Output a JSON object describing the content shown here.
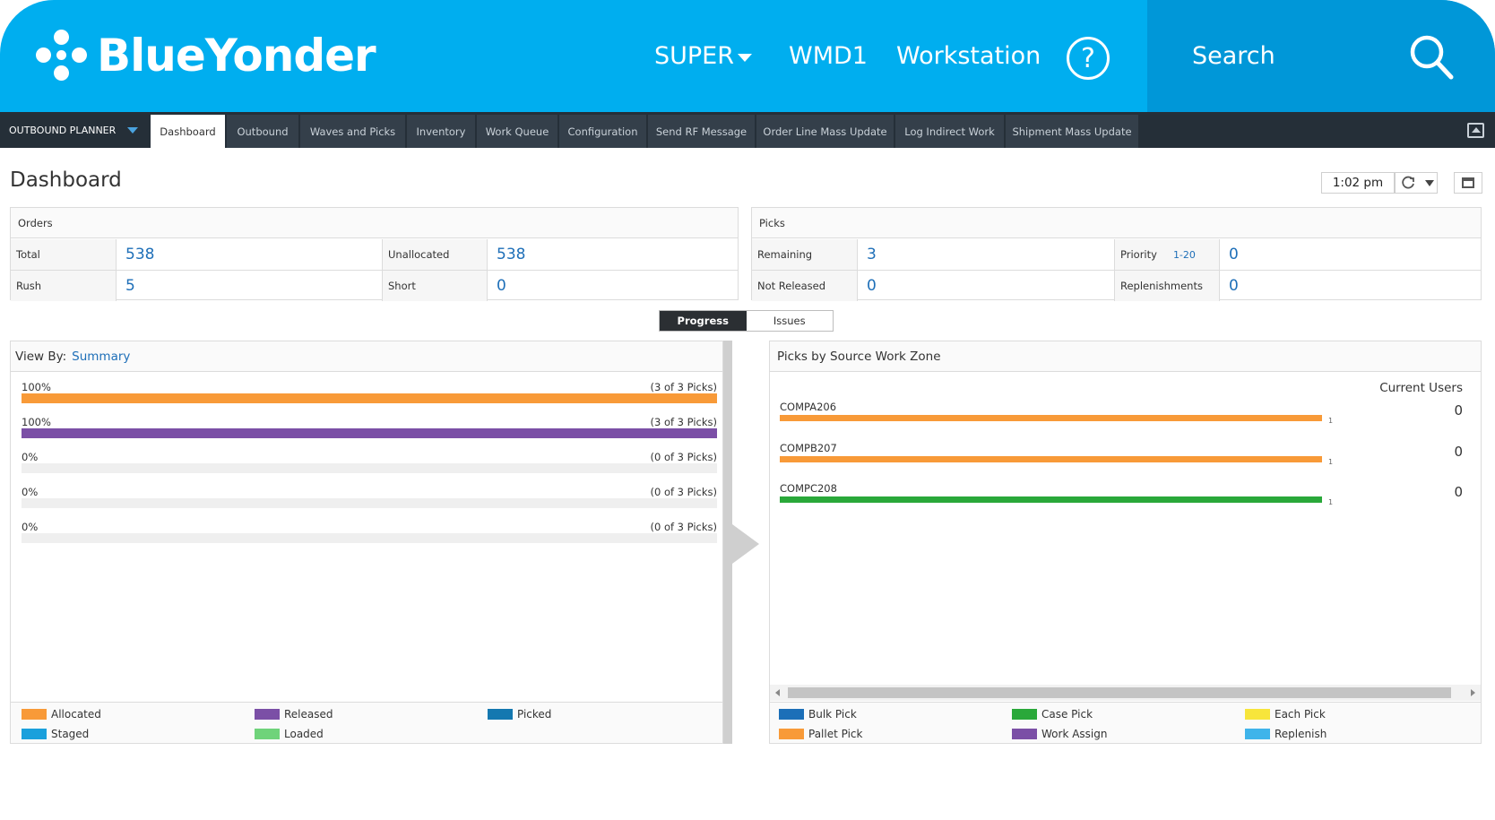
{
  "header": {
    "brand": "BlueYonder",
    "user": "SUPER",
    "warehouse": "WMD1",
    "workstation": "Workstation",
    "help": "?",
    "search_label": "Search"
  },
  "tabbar": {
    "planner": "OUTBOUND PLANNER",
    "tabs": [
      {
        "label": "Dashboard"
      },
      {
        "label": "Outbound"
      },
      {
        "label": "Waves and Picks"
      },
      {
        "label": "Inventory"
      },
      {
        "label": "Work Queue"
      },
      {
        "label": "Configuration"
      },
      {
        "label": "Send RF Message"
      },
      {
        "label": "Order Line Mass Update"
      },
      {
        "label": "Log Indirect Work"
      },
      {
        "label": "Shipment Mass Update"
      }
    ]
  },
  "page": {
    "title": "Dashboard",
    "time": "1:02 pm"
  },
  "orders": {
    "title": "Orders",
    "total_label": "Total",
    "total": "538",
    "unallocated_label": "Unallocated",
    "unallocated": "538",
    "rush_label": "Rush",
    "rush": "5",
    "short_label": "Short",
    "short": "0"
  },
  "picks": {
    "title": "Picks",
    "remaining_label": "Remaining",
    "remaining": "3",
    "priority_label": "Priority",
    "priority_range": "1-20",
    "priority": "0",
    "not_released_label": "Not Released",
    "not_released": "0",
    "replenishments_label": "Replenishments",
    "replenishments": "0"
  },
  "toggle": {
    "progress": "Progress",
    "issues": "Issues"
  },
  "progress": {
    "view_by_label": "View By:",
    "view_by_value": "Summary",
    "rows": [
      {
        "pct": "100%",
        "count": "(3 of 3 Picks)",
        "fraction": 1.0,
        "color": "#f89a38"
      },
      {
        "pct": "100%",
        "count": "(3 of 3 Picks)",
        "fraction": 1.0,
        "color": "#7b4fa6"
      },
      {
        "pct": "0%",
        "count": "(0 of 3 Picks)",
        "fraction": 0.0,
        "color": "#1478b0"
      },
      {
        "pct": "0%",
        "count": "(0 of 3 Picks)",
        "fraction": 0.0,
        "color": "#1aa0dc"
      },
      {
        "pct": "0%",
        "count": "(0 of 3 Picks)",
        "fraction": 0.0,
        "color": "#6fd37a"
      }
    ],
    "legend": [
      {
        "label": "Allocated",
        "color": "#f89a38"
      },
      {
        "label": "Released",
        "color": "#7b4fa6"
      },
      {
        "label": "Picked",
        "color": "#1478b0"
      },
      {
        "label": "Staged",
        "color": "#1aa0dc"
      },
      {
        "label": "Loaded",
        "color": "#6fd37a"
      }
    ]
  },
  "zones": {
    "title": "Picks by Source Work Zone",
    "current_users_label": "Current Users",
    "rows": [
      {
        "name": "COMPA206",
        "value": "1",
        "users": "0",
        "color": "#f89a38"
      },
      {
        "name": "COMPB207",
        "value": "1",
        "users": "0",
        "color": "#f89a38"
      },
      {
        "name": "COMPC208",
        "value": "1",
        "users": "0",
        "color": "#2aa83a"
      }
    ],
    "legend": [
      {
        "label": "Bulk Pick",
        "color": "#1c6fb8"
      },
      {
        "label": "Case Pick",
        "color": "#2aa83a"
      },
      {
        "label": "Each Pick",
        "color": "#f7e53b"
      },
      {
        "label": "Pallet Pick",
        "color": "#f89a38"
      },
      {
        "label": "Work Assign",
        "color": "#7b4fa6"
      },
      {
        "label": "Replenish",
        "color": "#3fb4ea"
      }
    ]
  }
}
